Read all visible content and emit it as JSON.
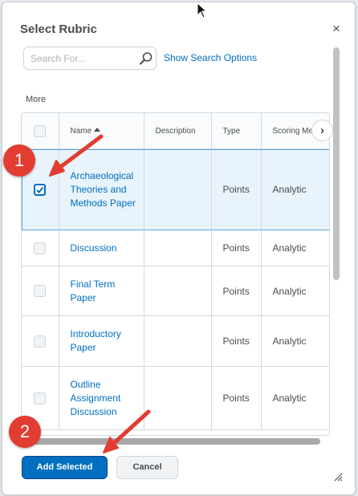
{
  "dialog": {
    "title": "Select Rubric",
    "close_label": "×"
  },
  "search": {
    "placeholder": "Search For...",
    "value": "",
    "show_options_label": "Show Search Options"
  },
  "more_label": "More",
  "table": {
    "columns": [
      "Name",
      "Description",
      "Type",
      "Scoring Me"
    ],
    "rows": [
      {
        "name": "Archaeological Theories and Methods Paper",
        "description": "",
        "type": "Points",
        "scoring": "Analytic",
        "checked": true
      },
      {
        "name": "Discussion",
        "description": "",
        "type": "Points",
        "scoring": "Analytic",
        "checked": false
      },
      {
        "name": "Final Term Paper",
        "description": "",
        "type": "Points",
        "scoring": "Analytic",
        "checked": false
      },
      {
        "name": "Introductory Paper",
        "description": "",
        "type": "Points",
        "scoring": "Analytic",
        "checked": false
      },
      {
        "name": "Outline Assignment Discussion",
        "description": "",
        "type": "Points",
        "scoring": "Analytic",
        "checked": false
      }
    ],
    "scroll_right_label": "›"
  },
  "buttons": {
    "add_selected": "Add Selected",
    "cancel": "Cancel"
  },
  "annotations": {
    "step1": "1",
    "step2": "2"
  },
  "colors": {
    "accent": "#006fbf",
    "badge": "#e23d30"
  }
}
